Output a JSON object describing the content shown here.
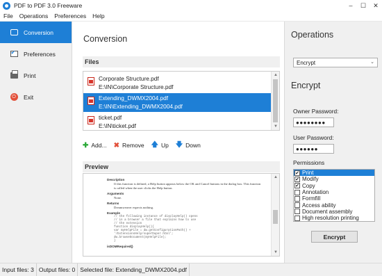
{
  "window": {
    "title": "PDF to PDF 3.0 Freeware",
    "controls": [
      "–",
      "☐",
      "✕"
    ]
  },
  "menu": [
    "File",
    "Operations",
    "Preferences",
    "Help"
  ],
  "sidebar": {
    "items": [
      {
        "label": "Conversion",
        "active": true
      },
      {
        "label": "Preferences"
      },
      {
        "label": "Print"
      },
      {
        "label": "Exit"
      }
    ]
  },
  "main": {
    "title": "Conversion",
    "files_header": "Files",
    "files": [
      {
        "name": "Corporate Structure.pdf",
        "path": "E:\\IN\\Corporate Structure.pdf"
      },
      {
        "name": "Extending_DWMX2004.pdf",
        "path": "E:\\IN\\Extending_DWMX2004.pdf",
        "selected": true
      },
      {
        "name": "ticket.pdf",
        "path": "E:\\IN\\ticket.pdf"
      }
    ],
    "toolbar": {
      "add": "Add...",
      "remove": "Remove",
      "up": "Up",
      "down": "Down"
    },
    "preview_header": "Preview",
    "preview_doc": {
      "description_h": "Description",
      "description": "If this function is defined, a Help button appears below the OK and Cancel buttons in the dialog box. This function is called when the user clicks the Help button.",
      "arguments_h": "Arguments",
      "arguments": "None.",
      "returns_h": "Returns",
      "returns": "Dreamweaver expects nothing.",
      "example_h": "Example",
      "code": [
        "// the following instance of displayHelp() opens",
        "// in a browser a file that explains how to use",
        "// the extension",
        "function displayHelp(){",
        "  var myHelpFile = dw.getConfigurationPath() +",
        "    '/ExtensionsHelp/superDuper.html';",
        "  dw.browseDocument(myHelpFile);",
        "}"
      ],
      "next_h": "isDOMRequired()"
    }
  },
  "operations": {
    "title": "Operations",
    "selected": "Encrypt",
    "encrypt_title": "Encrypt",
    "owner_label": "Owner Password:",
    "owner_value": "●●●●●●●●",
    "user_label": "User Password:",
    "user_value": "●●●●●●",
    "permissions_label": "Permissions",
    "permissions": [
      {
        "label": "Print",
        "checked": true,
        "selected": true
      },
      {
        "label": "Modify",
        "checked": true
      },
      {
        "label": "Copy",
        "checked": true
      },
      {
        "label": "Annotation",
        "checked": false
      },
      {
        "label": "Formfill",
        "checked": false
      },
      {
        "label": "Access ability",
        "checked": false
      },
      {
        "label": "Document assembly",
        "checked": false
      },
      {
        "label": "High resolution printing",
        "checked": false
      }
    ],
    "encrypt_button": "Encrypt"
  },
  "status": {
    "input": "Input files: 3",
    "output": "Output files: 0",
    "selected": "Selected file: Extending_DWMX2004.pdf"
  },
  "colors": {
    "accent": "#1e7fd6",
    "panel": "#f0f0f0"
  }
}
